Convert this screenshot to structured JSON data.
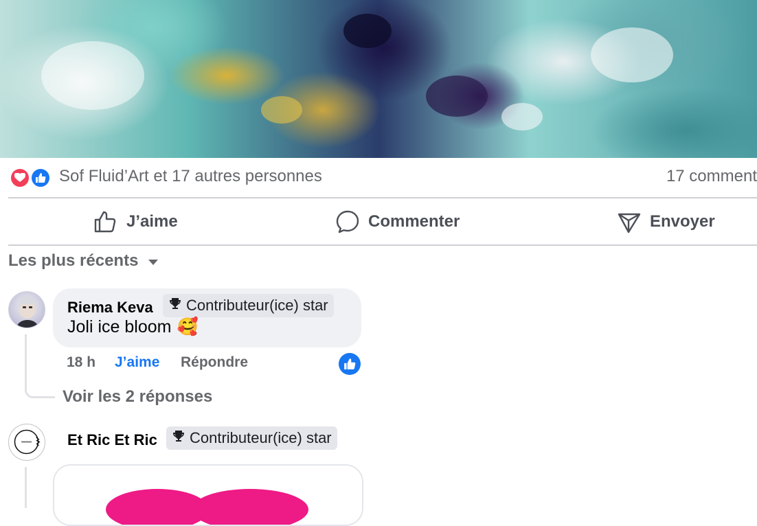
{
  "post": {
    "reactions_summary": "Sof Fluid’Art et 17 autres personnes",
    "comments_count": "17 comment",
    "colors": {
      "love": "#f33e58",
      "like": "#1877f2"
    }
  },
  "actions": {
    "like_label": "J’aime",
    "comment_label": "Commenter",
    "send_label": "Envoyer"
  },
  "sort": {
    "label": "Les plus récents"
  },
  "comments": [
    {
      "author": "Riema Keva",
      "badge": "Contributeur(ice) star",
      "text": "Joli ice bloom",
      "emoji": "🥰",
      "time": "18 h",
      "like_label": "J’aime",
      "reply_label": "Répondre",
      "view_replies": "Voir les 2 réponses"
    },
    {
      "author": "Et Ric Et Ric",
      "badge": "Contributeur(ice) star"
    }
  ],
  "icons": {
    "badge": "trophy-icon",
    "sort": "caret-down-icon",
    "like": "thumbs-up-icon",
    "comment": "comment-bubble-icon",
    "send": "send-icon"
  }
}
